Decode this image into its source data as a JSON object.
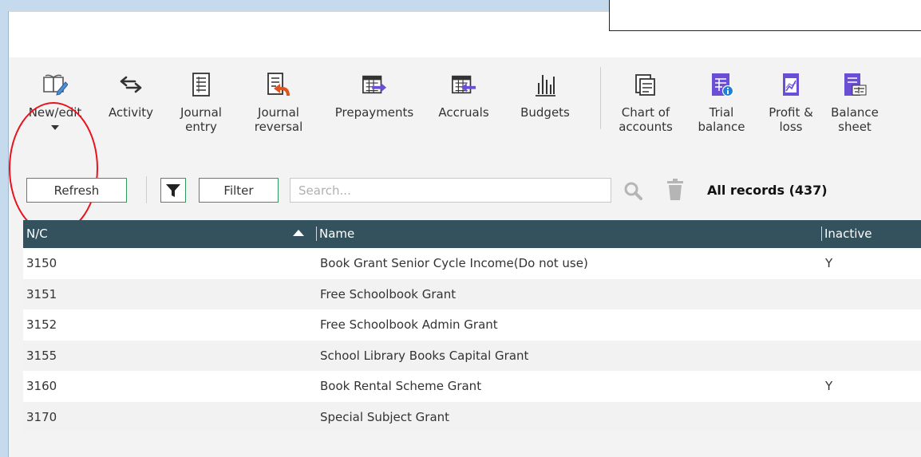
{
  "ribbon": {
    "group1": [
      {
        "label": "New/edit",
        "icon": "book-pencil-icon"
      },
      {
        "label": "Activity",
        "icon": "arrows-exchange-icon"
      },
      {
        "label": "Journal\nentry",
        "icon": "journal-icon"
      },
      {
        "label": "Journal\nreversal",
        "icon": "journal-reversal-icon"
      },
      {
        "label": "Prepayments",
        "icon": "prepayments-icon"
      },
      {
        "label": "Accruals",
        "icon": "accruals-icon"
      },
      {
        "label": "Budgets",
        "icon": "bar-chart-icon"
      }
    ],
    "group2": [
      {
        "label": "Chart of\naccounts",
        "icon": "chart-of-accounts-icon"
      },
      {
        "label": "Trial\nbalance",
        "icon": "trial-balance-icon"
      },
      {
        "label": "Profit &\nloss",
        "icon": "profit-loss-icon"
      },
      {
        "label": "Balance\nsheet",
        "icon": "balance-sheet-icon"
      }
    ]
  },
  "toolbar": {
    "refresh_label": "Refresh",
    "filter_label": "Filter",
    "search_placeholder": "Search...",
    "records_label": "All records (437)"
  },
  "grid": {
    "columns": [
      "N/C",
      "Name",
      "Inactive"
    ],
    "rows": [
      {
        "nc": "3150",
        "name": "Book Grant Senior Cycle Income(Do not use)",
        "inactive": "Y"
      },
      {
        "nc": "3151",
        "name": "Free Schoolbook Grant",
        "inactive": ""
      },
      {
        "nc": "3152",
        "name": "Free Schoolbook Admin Grant",
        "inactive": ""
      },
      {
        "nc": "3155",
        "name": "School Library Books Capital Grant",
        "inactive": ""
      },
      {
        "nc": "3160",
        "name": "Book Rental Scheme Grant",
        "inactive": "Y"
      },
      {
        "nc": "3170",
        "name": "Special Subject Grant",
        "inactive": ""
      }
    ]
  },
  "colors": {
    "header_bg": "#34525e",
    "accent_green": "#2f9a5d",
    "annotation_red": "#e8131c",
    "icon_purple": "#6a4fd6",
    "icon_orange": "#e0531f"
  }
}
